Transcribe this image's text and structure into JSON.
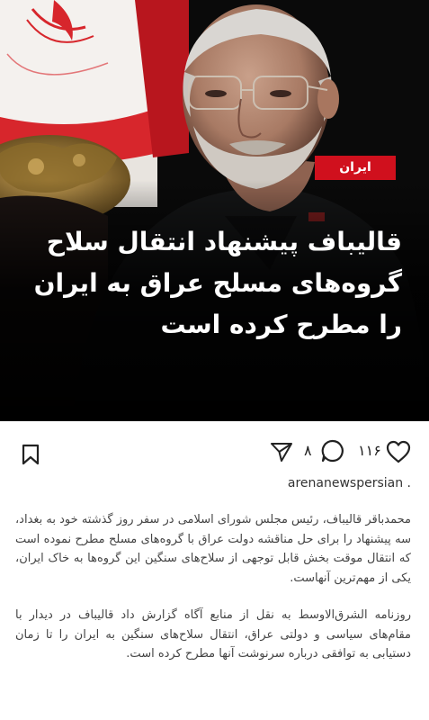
{
  "post": {
    "category_tag": "ایران",
    "headline": "قالیباف پیشنهاد انتقال سلاح گروه‌های مسلح عراق به ایران را مطرح کرده است",
    "like_count": "۱۱۶",
    "comment_count": "۸",
    "author": "arenanewspersian .",
    "caption_paragraphs": [
      "محمدباقر قالیباف، رئیس مجلس شورای اسلامی در سفر روز گذشته خود به بغداد، سه پیشنهاد را برای حل مناقشه دولت عراق با گروه‌های مسلح مطرح نموده است که انتقال موقت بخش قابل توجهی از سلاح‌های سنگین این گروه‌ها به خاک ایران، یکی از مهم‌ترین آنهاست.",
      "روزنامه الشرق‌الاوسط به نقل از منابع آگاه گزارش داد قالیباف در دیدار با مقام‌های سیاسی و دولتی عراق، انتقال سلاح‌های سنگین به ایران را تا زمان دستیابی به توافقی درباره سرنوشت آنها مطرح کرده است."
    ]
  },
  "colors": {
    "tag_red": "#d0101d",
    "headline_text": "#ffffff",
    "hero_background": "#050505",
    "icon_stroke": "#222222"
  },
  "icons": {
    "bookmark": "bookmark-icon",
    "like": "heart-icon",
    "comment": "comment-icon",
    "share": "paper-plane-icon"
  }
}
